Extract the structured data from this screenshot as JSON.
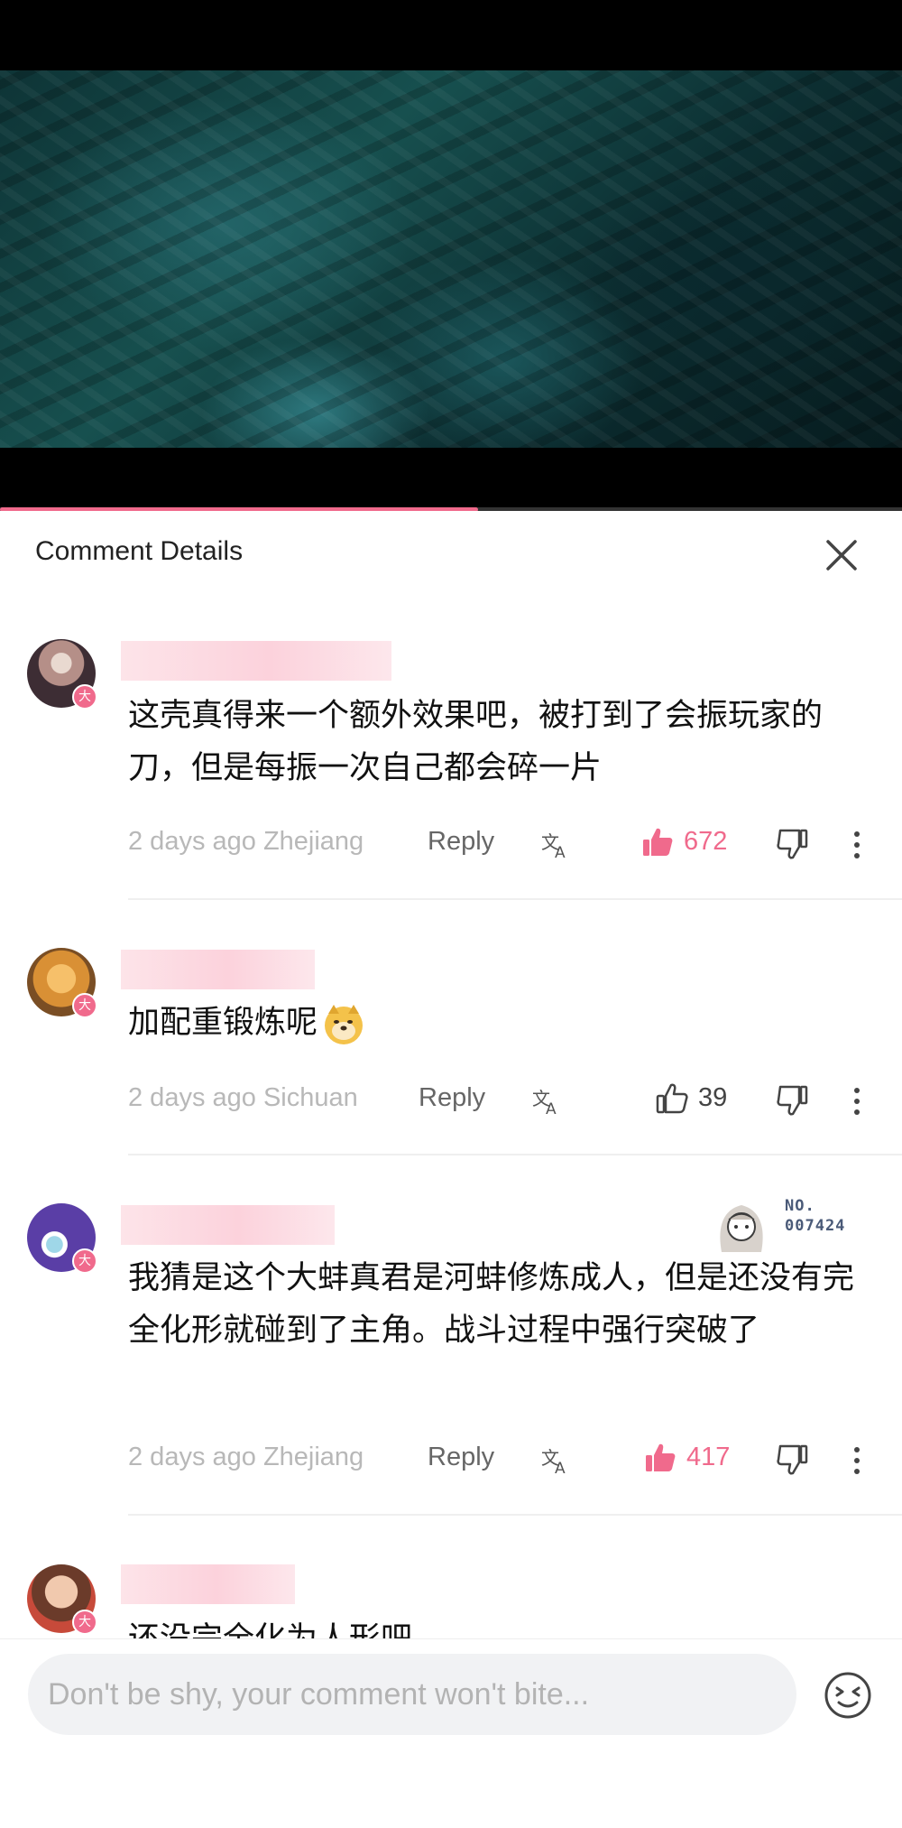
{
  "video": {
    "progress": 0.53,
    "progress_color": "#f06a8c"
  },
  "header": {
    "title": "Comment Details"
  },
  "comments": [
    {
      "text": "这壳真得来一个额外效果吧，被打到了会振玩家的刀，但是每振一次自己都会碎一片",
      "time_location": "2 days ago Zhejiang",
      "reply_label": "Reply",
      "likes": "672",
      "liked": true
    },
    {
      "text": "加配重锻炼呢",
      "emoji": "doge-emoji",
      "time_location": "2 days ago Sichuan",
      "reply_label": "Reply",
      "likes": "39",
      "liked": false
    },
    {
      "text": "我猜是这个大蚌真君是河蚌修炼成人，但是还没有完全化形就碰到了主角。战斗过程中强行突破了",
      "time_location": "2 days ago Zhejiang",
      "reply_label": "Reply",
      "likes": "417",
      "liked": true,
      "medal": {
        "line1": "NO.",
        "line2": "007424"
      }
    },
    {
      "text": "还没完全化为人形吧"
    }
  ],
  "badge_char": "大",
  "input": {
    "placeholder": "Don't be shy, your comment won't bite..."
  },
  "colors": {
    "accent": "#f06a8c",
    "muted": "#b8b8b8"
  }
}
